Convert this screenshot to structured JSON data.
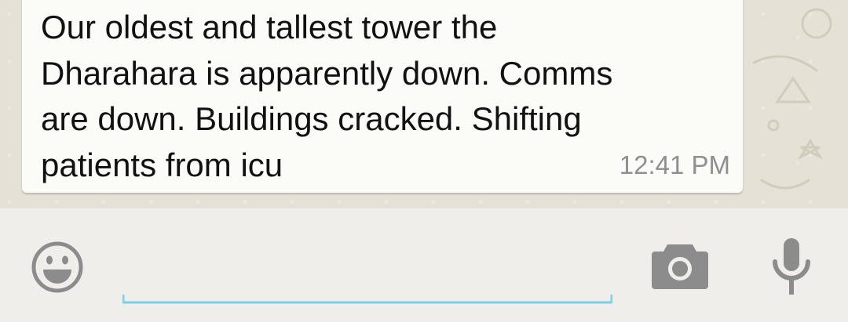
{
  "message": {
    "text": "Our oldest and tallest tower the\nDharahara  is apparently  down. Comms\nare down. Buildings  cracked. Shifting\npatients  from icu",
    "time": "12:41 PM"
  },
  "input": {
    "placeholder": "",
    "value": ""
  },
  "icons": {
    "emoji": "smiley-face-icon",
    "camera": "camera-icon",
    "mic": "microphone-icon"
  },
  "colors": {
    "chat_background": "#e6e1d6",
    "bubble": "#fbfbf8",
    "input_bar": "#efeeea",
    "input_underline": "#7fcfe3",
    "icon_gray": "#8c8c8c"
  }
}
